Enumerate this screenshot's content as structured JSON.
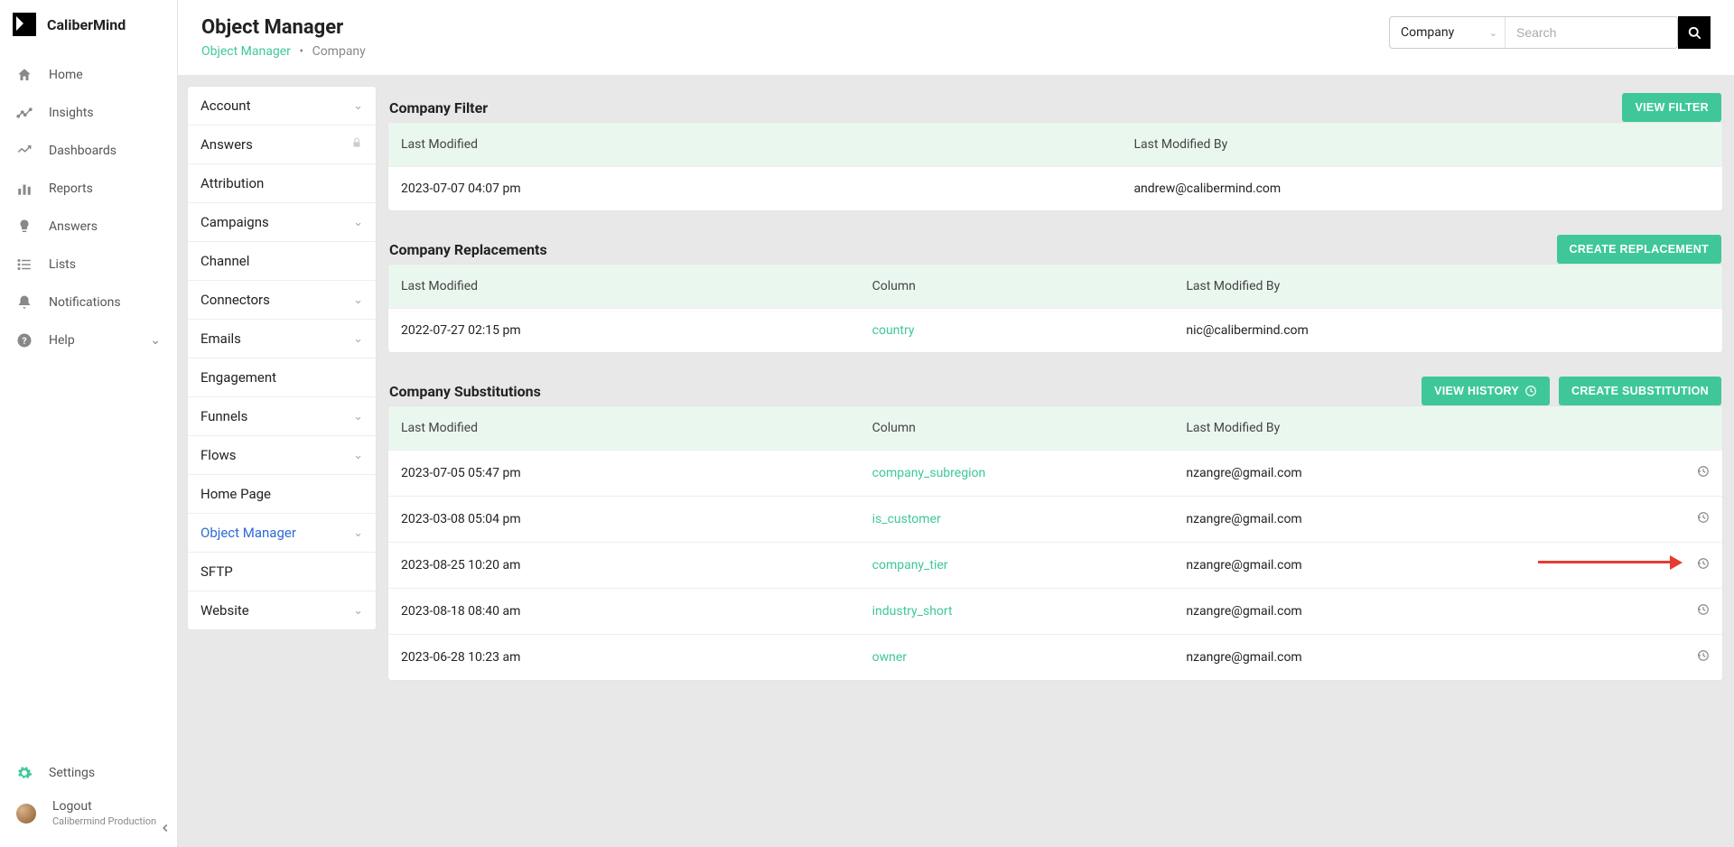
{
  "brand": {
    "name": "CaliberMind"
  },
  "nav": {
    "home": "Home",
    "insights": "Insights",
    "dashboards": "Dashboards",
    "reports": "Reports",
    "answers": "Answers",
    "lists": "Lists",
    "notifications": "Notifications",
    "help": "Help"
  },
  "sidebar_bottom": {
    "settings": "Settings",
    "logout": "Logout",
    "tenant": "Calibermind Production"
  },
  "header": {
    "title": "Object Manager",
    "bc_link": "Object Manager",
    "bc_sep": "•",
    "bc_current": "Company",
    "select_value": "Company",
    "search_placeholder": "Search"
  },
  "objects": {
    "account": "Account",
    "answers": "Answers",
    "attribution": "Attribution",
    "campaigns": "Campaigns",
    "channel": "Channel",
    "connectors": "Connectors",
    "emails": "Emails",
    "engagement": "Engagement",
    "funnels": "Funnels",
    "flows": "Flows",
    "home_page": "Home Page",
    "object_manager": "Object Manager",
    "sftp": "SFTP",
    "website": "Website"
  },
  "sections": {
    "filter": {
      "title": "Company Filter",
      "button": "VIEW FILTER",
      "head_a": "Last Modified",
      "head_c": "Last Modified By",
      "row": {
        "a": "2023-07-07 04:07 pm",
        "c": "andrew@calibermind.com"
      }
    },
    "replacements": {
      "title": "Company Replacements",
      "button": "CREATE REPLACEMENT",
      "head_a": "Last Modified",
      "head_b": "Column",
      "head_c": "Last Modified By",
      "row": {
        "a": "2022-07-27 02:15 pm",
        "b": "country",
        "c": "nic@calibermind.com"
      }
    },
    "substitutions": {
      "title": "Company Substitutions",
      "btn_history": "VIEW HISTORY",
      "btn_create": "CREATE SUBSTITUTION",
      "head_a": "Last Modified",
      "head_b": "Column",
      "head_c": "Last Modified By",
      "rows": [
        {
          "a": "2023-07-05 05:47 pm",
          "b": "company_subregion",
          "c": "nzangre@gmail.com"
        },
        {
          "a": "2023-03-08 05:04 pm",
          "b": "is_customer",
          "c": "nzangre@gmail.com"
        },
        {
          "a": "2023-08-25 10:20 am",
          "b": "company_tier",
          "c": "nzangre@gmail.com"
        },
        {
          "a": "2023-08-18 08:40 am",
          "b": "industry_short",
          "c": "nzangre@gmail.com"
        },
        {
          "a": "2023-06-28 10:23 am",
          "b": "owner",
          "c": "nzangre@gmail.com"
        }
      ]
    }
  }
}
